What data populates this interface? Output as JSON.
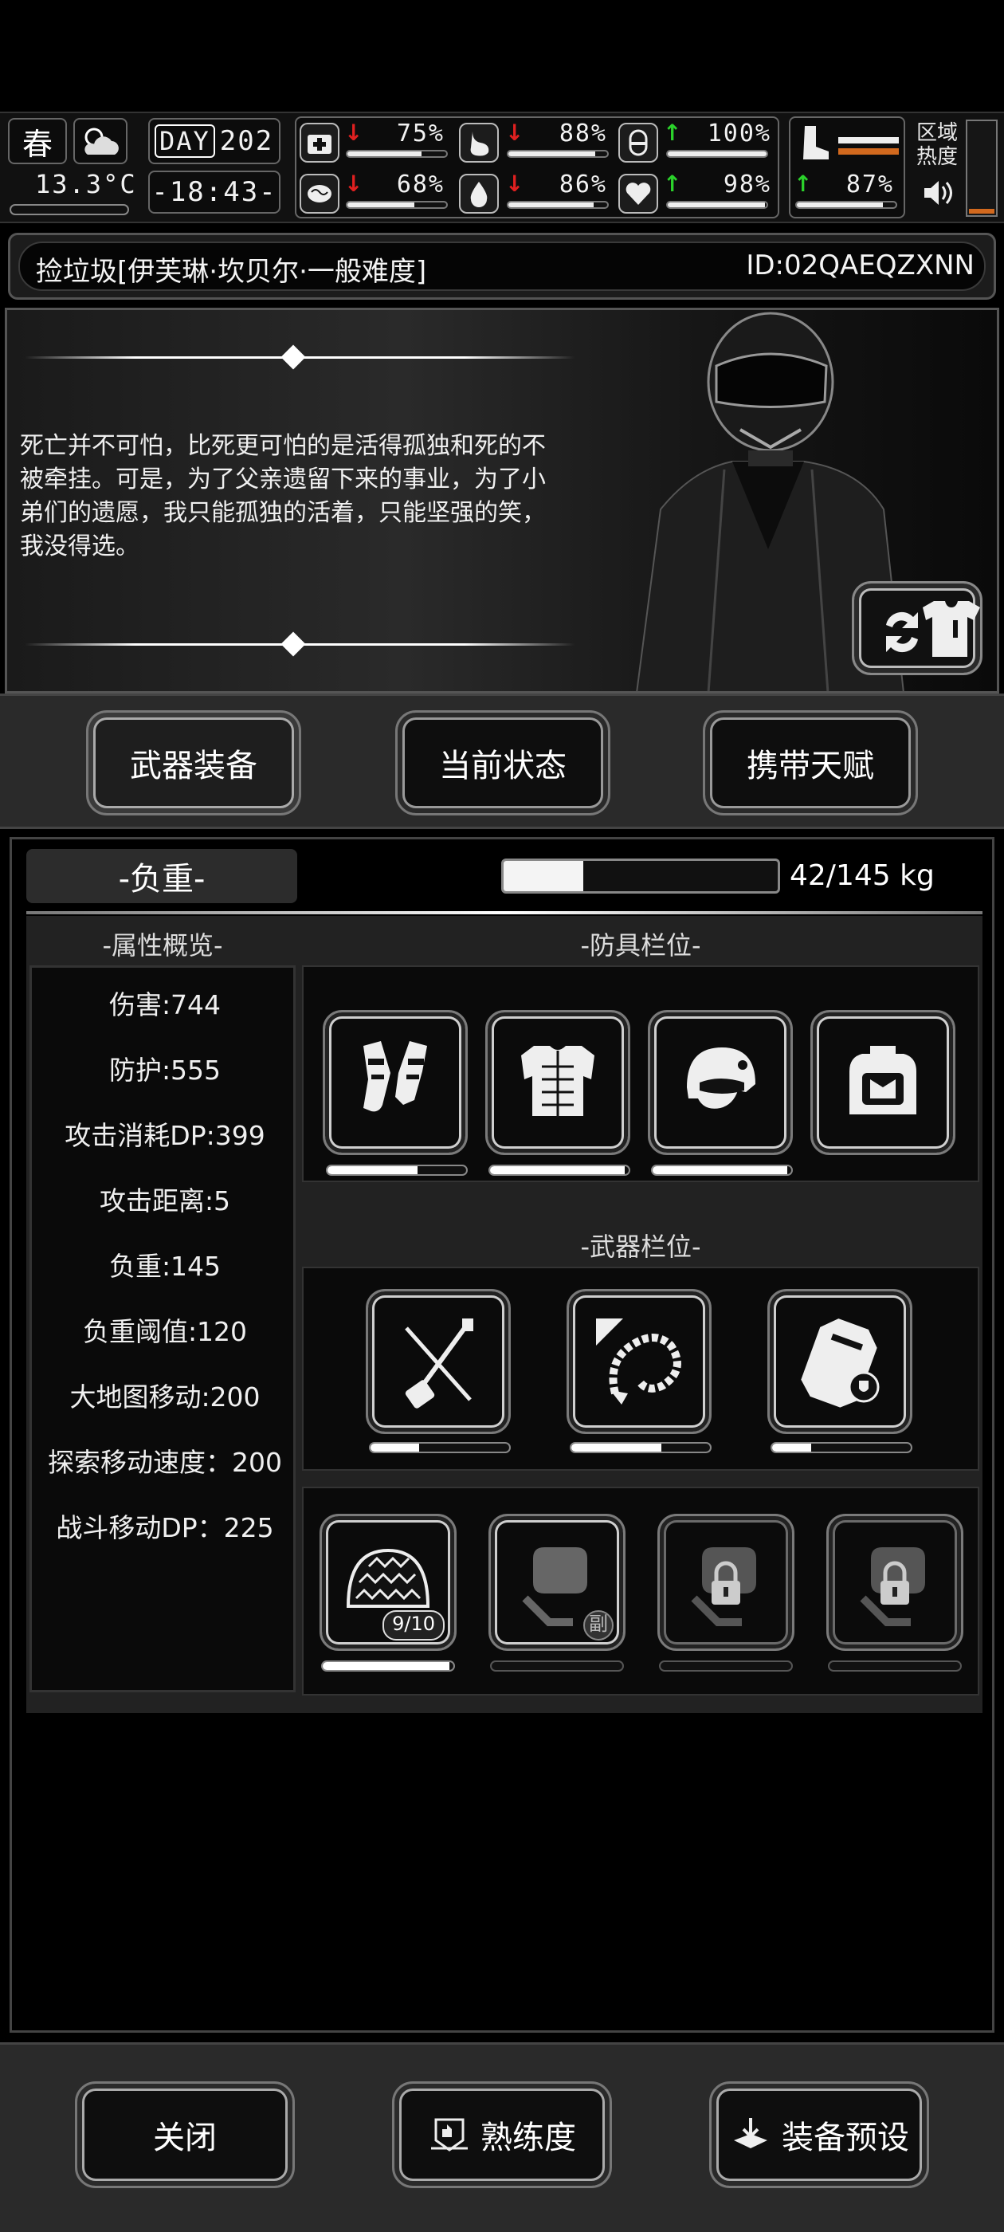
{
  "hud": {
    "season": "春",
    "temperature": "13.3°C",
    "day_label": "DAY",
    "day_number": "202",
    "clock": "-18:43-",
    "zone_heat_label": "区域\n热度",
    "stats": [
      {
        "icon": "medkit-icon",
        "trend": "down",
        "value": "75%",
        "fill": 0.75
      },
      {
        "icon": "stomach-icon",
        "trend": "down",
        "value": "88%",
        "fill": 0.88
      },
      {
        "icon": "capsule-icon",
        "trend": "up",
        "value": "100%",
        "fill": 1.0
      },
      {
        "icon": "brain-icon",
        "trend": "down",
        "value": "68%",
        "fill": 0.68
      },
      {
        "icon": "water-drop-icon",
        "trend": "down",
        "value": "86%",
        "fill": 0.86
      },
      {
        "icon": "heart-icon",
        "trend": "up",
        "value": "98%",
        "fill": 0.98
      },
      {
        "icon": "boot-icon",
        "trend": "up",
        "value": "87%",
        "fill": 0.87
      }
    ]
  },
  "header": {
    "title": "捡垃圾[伊芙琳·坎贝尔·一般难度]",
    "id": "ID:02QAEQZXNN"
  },
  "banner": {
    "quote": "死亡并不可怕，比死更可怕的是活得孤独和死的不被牵挂。可是，为了父亲遗留下来的事业，为了小弟们的遗愿，我只能孤独的活着，只能坚强的笑，我没得选。"
  },
  "tabs": [
    {
      "label": "武器装备",
      "active": true
    },
    {
      "label": "当前状态",
      "active": false
    },
    {
      "label": "携带天赋",
      "active": false
    }
  ],
  "load": {
    "label": "-负重-",
    "current": 42,
    "max": 145,
    "text": "42/145 kg"
  },
  "attributes": {
    "heading": "-属性概览-",
    "items": [
      "伤害:744",
      "防护:555",
      "攻击消耗DP:399",
      "攻击距离:5",
      "负重:145",
      "负重阈值:120",
      "大地图移动:200",
      "探索移动速度：200",
      "战斗移动DP：225"
    ]
  },
  "armor": {
    "heading": "-防具栏位-",
    "slots": [
      {
        "icon": "gauntlets-icon",
        "durability": 0.65
      },
      {
        "icon": "body-armor-icon",
        "durability": 0.97
      },
      {
        "icon": "helmet-icon",
        "durability": 0.97
      },
      {
        "icon": "backpack-icon",
        "durability": null
      }
    ]
  },
  "weapons": {
    "heading": "-武器栏位-",
    "slots": [
      {
        "icon": "sanxian-guitar-icon",
        "durability": 0.35
      },
      {
        "icon": "scorpion-whip-icon",
        "durability": 0.65
      },
      {
        "icon": "shield-case-icon",
        "durability": 0.28
      }
    ]
  },
  "extra_slots": [
    {
      "icon": "spiked-shell-icon",
      "badge": "9/10",
      "durability": 0.97,
      "locked": false
    },
    {
      "icon": "fist-icon",
      "badge": "副",
      "durability": 0,
      "locked": false
    },
    {
      "icon": "fist-locked-icon",
      "badge": "",
      "durability": 0,
      "locked": true
    },
    {
      "icon": "fist-locked-icon",
      "badge": "",
      "durability": 0,
      "locked": true
    }
  ],
  "footer": {
    "close": "关闭",
    "proficiency": "熟练度",
    "preset": "装备预设"
  }
}
